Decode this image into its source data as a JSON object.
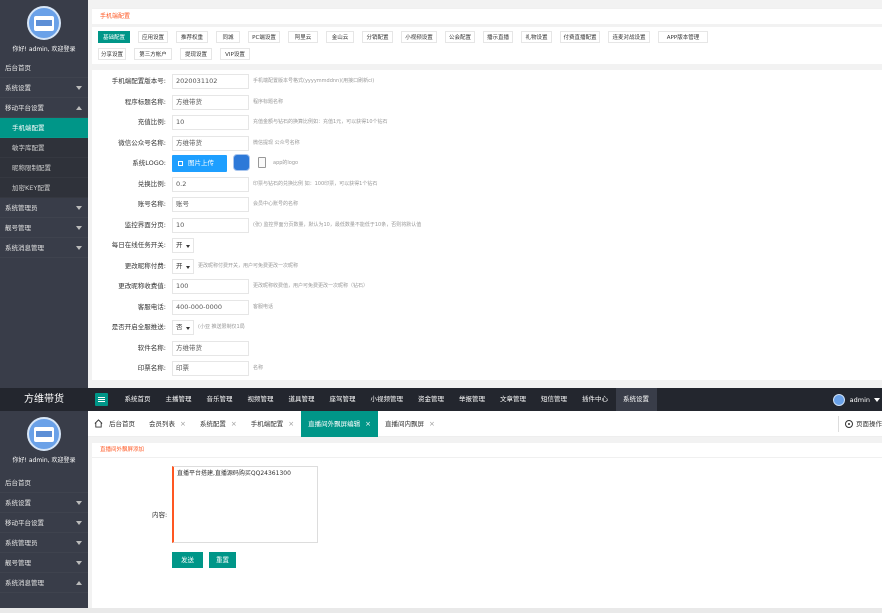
{
  "upper": {
    "greeting": "你好! admin, 欢迎登录",
    "nav": [
      {
        "label": "后台首页",
        "arrow": ""
      },
      {
        "label": "系统设置",
        "arrow": "down"
      },
      {
        "label": "移动平台设置",
        "arrow": "up"
      }
    ],
    "subnav": [
      {
        "label": "手机端配置",
        "active": true
      },
      {
        "label": "敏字库配置",
        "active": false
      },
      {
        "label": "昵称限制配置",
        "active": false
      },
      {
        "label": "加密KEY配置",
        "active": false
      }
    ],
    "nav2": [
      {
        "label": "系统管理员"
      },
      {
        "label": "靓号管理"
      },
      {
        "label": "系统消息管理"
      }
    ],
    "card_title": "手机端配置",
    "tabs_row1": [
      "基础配置",
      "应用设置",
      "推荐权重",
      "同城",
      "PC端设置",
      "阿里云",
      "金山云",
      "分销配置",
      "小视频设置",
      "公会配置",
      "播示直播",
      "礼物设置",
      "付费直播配置",
      "连麦对战设置",
      "APP版本管理"
    ],
    "tabs_row2": [
      "分享设置",
      "第三方帐户",
      "提现设置",
      "VIP设置"
    ],
    "form": [
      {
        "label": "手机端配置版本号:",
        "value": "2020031102",
        "hint": "手机端配置版本号格式(yyyymmddnn)(用接口刷新ci)",
        "type": "input"
      },
      {
        "label": "程序标题名称:",
        "value": "方维带货",
        "hint": "程序标题名称",
        "type": "input"
      },
      {
        "label": "充值比例:",
        "value": "10",
        "hint": "充值金额与钻石的换算比例如：充值1元，可以获得10个钻石",
        "type": "input"
      },
      {
        "label": "微信公众号名称:",
        "value": "方维带货",
        "hint": "微信提现 公众号名称",
        "type": "input"
      },
      {
        "label": "系统LOGO:",
        "value": "图片上传",
        "hint": "app的logo",
        "type": "upload"
      },
      {
        "label": "兑换比例:",
        "value": "0.2",
        "hint": "印票与钻石的兑换比例 如：100印票，可以获得1个钻石",
        "type": "input"
      },
      {
        "label": "账号名称:",
        "value": "账号",
        "hint": "会员中心账号的名称",
        "type": "input"
      },
      {
        "label": "监控界面分页:",
        "value": "10",
        "hint": "(张) 监控界面分页数量，默认为10，最低数量不能低于10条，否则将默认值",
        "type": "input"
      },
      {
        "label": "每日在线任务开关:",
        "value": "开",
        "hint": "",
        "type": "select"
      },
      {
        "label": "更改昵称付费:",
        "value": "开",
        "hint": "更改昵称付费开关，用户可免费更改一次昵称",
        "type": "select"
      },
      {
        "label": "更改昵称收费值:",
        "value": "100",
        "hint": "更改昵称收费值，用户可免费更改一次昵称（钻石）",
        "type": "input"
      },
      {
        "label": "客服电话:",
        "value": "400-000-0000",
        "hint": "客服电话",
        "type": "input"
      },
      {
        "label": "是否开启全服推送:",
        "value": "否",
        "hint": "(小亚 推送限制仅1局",
        "type": "select"
      },
      {
        "label": "软件名称:",
        "value": "方维带货",
        "hint": "",
        "type": "input"
      },
      {
        "label": "印票名称:",
        "value": "印票",
        "hint": "名称",
        "type": "input"
      }
    ]
  },
  "topbar": {
    "brand": "方维带货",
    "menu": [
      "系统首页",
      "主播管理",
      "音乐管理",
      "视频管理",
      "道具管理",
      "座驾管理",
      "小视频管理",
      "资金管理",
      "举报管理",
      "文章管理",
      "短信管理",
      "插件中心",
      "系统设置"
    ],
    "current_menu": "系统设置",
    "user": "admin"
  },
  "lower": {
    "greeting": "你好! admin, 欢迎登录",
    "nav": [
      {
        "label": "后台首页",
        "arrow": ""
      },
      {
        "label": "系统设置",
        "arrow": "down"
      },
      {
        "label": "移动平台设置",
        "arrow": "down"
      },
      {
        "label": "系统管理员",
        "arrow": "down"
      },
      {
        "label": "靓号管理",
        "arrow": "down"
      },
      {
        "label": "系统消息管理",
        "arrow": "up"
      }
    ],
    "tabs": [
      {
        "label": "后台首页",
        "closable": false
      },
      {
        "label": "会员列表",
        "closable": true
      },
      {
        "label": "系统配置",
        "closable": true
      },
      {
        "label": "手机端配置",
        "closable": true
      },
      {
        "label": "直播间外飘屏编辑",
        "closable": true,
        "current": true
      },
      {
        "label": "直播间内飘屏",
        "closable": true
      }
    ],
    "page_ops": "页面操作",
    "card_head": "直播间外飘屏添加",
    "content_label": "内容:",
    "content_value": "直播平台搭建,直播源码购买QQ24361300",
    "send_label": "发送",
    "reset_label": "重置"
  },
  "colors": {
    "accent": "#009688",
    "sidebar": "#393d49",
    "topbar": "#23262e",
    "hint": "#ff5722",
    "upload": "#1e9fff"
  }
}
